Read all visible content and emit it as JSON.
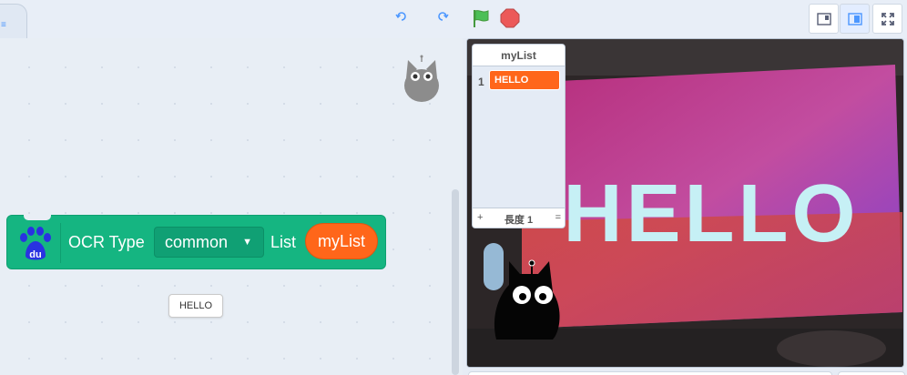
{
  "menu": {
    "tab_glyph": "≡"
  },
  "toolbar": {
    "undo_icon": "undo-icon",
    "redo_icon": "redo-icon",
    "flag_color": "#4caf50",
    "stop_color": "#ec5959"
  },
  "block": {
    "extension": "Baidu AI",
    "icon_text": "du",
    "ocr_label": "OCR Type",
    "ocr_type_value": "common",
    "list_label": "List",
    "list_reporter": "myList",
    "color": "#15b581"
  },
  "result_bubble": "HELLO",
  "stage": {
    "camera_text": "HELLO",
    "list_monitor": {
      "title": "myList",
      "items": [
        {
          "index": "1",
          "value": "HELLO"
        }
      ],
      "add": "+",
      "length_label": "長度 1",
      "resize": "="
    }
  },
  "colors": {
    "accent": "#4c97ff",
    "list_orange": "#ff661a"
  }
}
